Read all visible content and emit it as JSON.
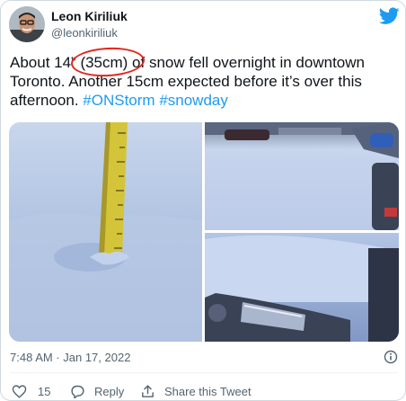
{
  "author": {
    "name": "Leon Kiriliuk",
    "handle": "@leonkiriliuk"
  },
  "tweet": {
    "text_main": "About 14” (35cm) of snow fell overnight in downtown Toronto. Another 15cm expected before it’s over this afternoon. ",
    "hashtag_1": "#ONStorm",
    "hashtag_2": "#snowday"
  },
  "meta": {
    "timestamp": "7:48 AM · Jan 17, 2022"
  },
  "actions": {
    "like_count": "15",
    "reply_label": "Reply",
    "share_label": "Share this Tweet"
  },
  "colors": {
    "accent": "#1d9bf0",
    "annotation_circle": "#e3261c"
  },
  "icons": [
    "twitter-bird-icon",
    "info-icon",
    "heart-icon",
    "reply-icon",
    "share-icon"
  ]
}
